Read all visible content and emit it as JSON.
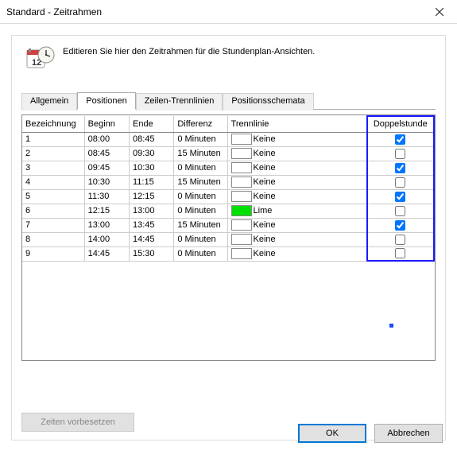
{
  "window": {
    "title": "Standard - Zeitrahmen"
  },
  "info": "Editieren Sie hier den Zeitrahmen für die Stundenplan-Ansichten.",
  "tabs": {
    "allgemein": "Allgemein",
    "positionen": "Positionen",
    "trennlinien": "Zeilen-Trennlinien",
    "schemata": "Positionsschemata"
  },
  "columns": {
    "bezeichnung": "Bezeichnung",
    "beginn": "Beginn",
    "ende": "Ende",
    "differenz": "Differenz",
    "trennlinie": "Trennlinie",
    "doppelstunde": "Doppelstunde"
  },
  "rows": [
    {
      "bez": "1",
      "beg": "08:00",
      "end": "08:45",
      "diff": "0 Minuten",
      "trenn_color": "#ffffff",
      "trenn_label": "Keine",
      "dopp": true
    },
    {
      "bez": "2",
      "beg": "08:45",
      "end": "09:30",
      "diff": "15 Minuten",
      "trenn_color": "#ffffff",
      "trenn_label": "Keine",
      "dopp": false
    },
    {
      "bez": "3",
      "beg": "09:45",
      "end": "10:30",
      "diff": "0 Minuten",
      "trenn_color": "#ffffff",
      "trenn_label": "Keine",
      "dopp": true
    },
    {
      "bez": "4",
      "beg": "10:30",
      "end": "11:15",
      "diff": "15 Minuten",
      "trenn_color": "#ffffff",
      "trenn_label": "Keine",
      "dopp": false
    },
    {
      "bez": "5",
      "beg": "11:30",
      "end": "12:15",
      "diff": "0 Minuten",
      "trenn_color": "#ffffff",
      "trenn_label": "Keine",
      "dopp": true
    },
    {
      "bez": "6",
      "beg": "12:15",
      "end": "13:00",
      "diff": "0 Minuten",
      "trenn_color": "#00e000",
      "trenn_label": "Lime",
      "dopp": false
    },
    {
      "bez": "7",
      "beg": "13:00",
      "end": "13:45",
      "diff": "15 Minuten",
      "trenn_color": "#ffffff",
      "trenn_label": "Keine",
      "dopp": true
    },
    {
      "bez": "8",
      "beg": "14:00",
      "end": "14:45",
      "diff": "0 Minuten",
      "trenn_color": "#ffffff",
      "trenn_label": "Keine",
      "dopp": false
    },
    {
      "bez": "9",
      "beg": "14:45",
      "end": "15:30",
      "diff": "0 Minuten",
      "trenn_color": "#ffffff",
      "trenn_label": "Keine",
      "dopp": false
    }
  ],
  "buttons": {
    "preset": "Zeiten vorbesetzen",
    "ok": "OK",
    "cancel": "Abbrechen"
  }
}
